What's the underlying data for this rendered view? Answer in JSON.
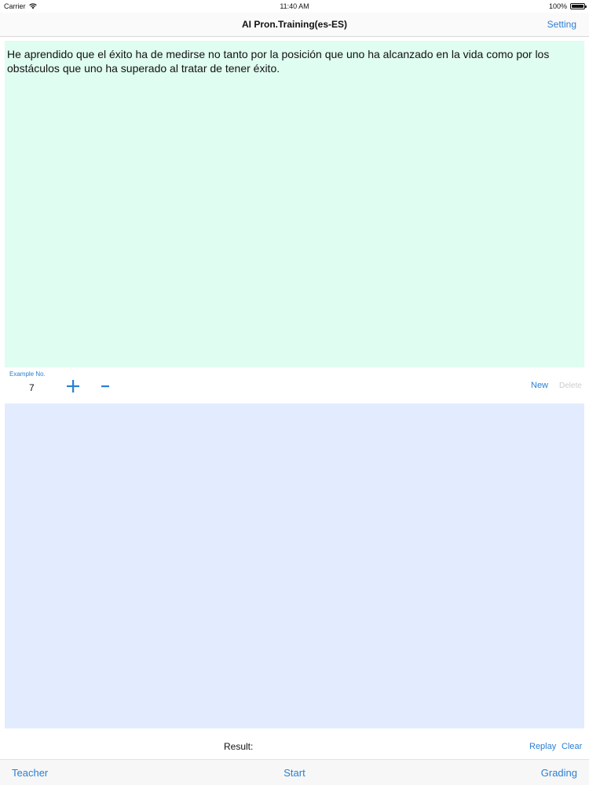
{
  "status_bar": {
    "carrier": "Carrier",
    "time": "11:40 AM",
    "battery": "100%"
  },
  "nav": {
    "title": "AI Pron.Training(es-ES)",
    "setting_label": "Setting"
  },
  "sentence_text": "He aprendido que el éxito ha de medirse no tanto por la posición que uno ha alcanzado en la vida como por los obstáculos que uno ha superado al tratar de tener éxito.",
  "example": {
    "label": "Example No.",
    "value": "7",
    "new_label": "New",
    "delete_label": "Delete"
  },
  "result": {
    "label": "Result:",
    "replay_label": "Replay",
    "clear_label": "Clear"
  },
  "toolbar": {
    "teacher_label": "Teacher",
    "start_label": "Start",
    "grading_label": "Grading"
  },
  "colors": {
    "accent": "#2a7fd4",
    "text_panel_bg": "#dffdf0",
    "result_panel_bg": "#e2ecfe",
    "disabled": "#cccccc"
  },
  "icons": {
    "status_wifi": "wifi-icon",
    "status_battery": "battery-icon",
    "increment": "plus-icon",
    "decrement": "minus-icon"
  }
}
